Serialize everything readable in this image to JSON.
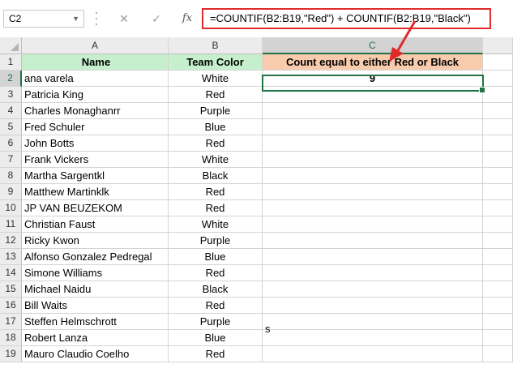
{
  "formula_bar": {
    "name_box": "C2",
    "cancel_glyph": "✕",
    "enter_glyph": "✓",
    "fx_label": "fx",
    "formula": "=COUNTIF(B2:B19,\"Red\") + COUNTIF(B2:B19,\"Black\")"
  },
  "columns": [
    "A",
    "B",
    "C"
  ],
  "header_row": {
    "row": "1",
    "name": "Name",
    "team_color": "Team Color",
    "count": "Count equal to either Red or Black"
  },
  "result": {
    "row": "2",
    "value": "9"
  },
  "stray_text": "s",
  "rows": [
    {
      "row": "2",
      "name": "ana varela",
      "color": "White"
    },
    {
      "row": "3",
      "name": "Patricia King",
      "color": "Red"
    },
    {
      "row": "4",
      "name": "Charles Monaghanrr",
      "color": "Purple"
    },
    {
      "row": "5",
      "name": "Fred Schuler",
      "color": "Blue"
    },
    {
      "row": "6",
      "name": "John Botts",
      "color": "Red"
    },
    {
      "row": "7",
      "name": "Frank Vickers",
      "color": "White"
    },
    {
      "row": "8",
      "name": "Martha Sargentkl",
      "color": "Black"
    },
    {
      "row": "9",
      "name": "Matthew Martinklk",
      "color": "Red"
    },
    {
      "row": "10",
      "name": "JP VAN BEUZEKOM",
      "color": "Red"
    },
    {
      "row": "11",
      "name": "Christian Faust",
      "color": "White"
    },
    {
      "row": "12",
      "name": "Ricky Kwon",
      "color": "Purple"
    },
    {
      "row": "13",
      "name": "Alfonso Gonzalez Pedregal",
      "color": "Blue"
    },
    {
      "row": "14",
      "name": "Simone Williams",
      "color": "Red"
    },
    {
      "row": "15",
      "name": "Michael Naidu",
      "color": "Black"
    },
    {
      "row": "16",
      "name": "Bill Waits",
      "color": "Red"
    },
    {
      "row": "17",
      "name": "Steffen Helmschrott",
      "color": "Purple"
    },
    {
      "row": "18",
      "name": "Robert Lanza",
      "color": "Blue"
    },
    {
      "row": "19",
      "name": "Mauro Claudio Coelho",
      "color": "Red"
    }
  ],
  "colors": {
    "header_green": "#c6efce",
    "header_peach": "#f8cbad",
    "selection": "#217346",
    "formula_highlight": "#e02b2b"
  }
}
